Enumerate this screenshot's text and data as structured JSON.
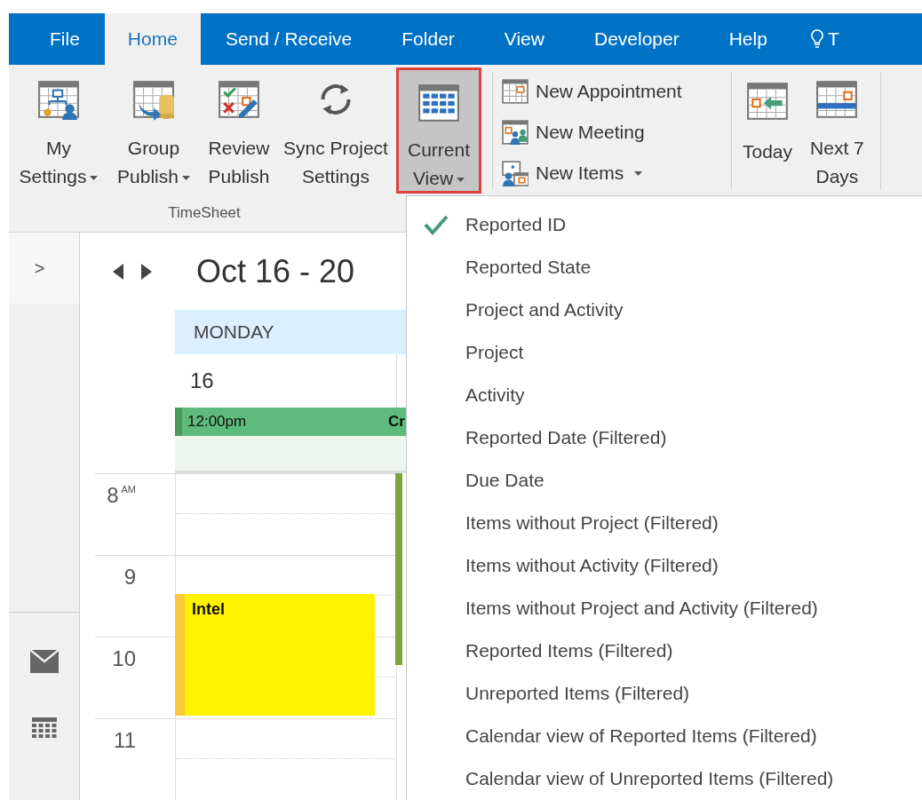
{
  "tabs": [
    {
      "label": "File",
      "selected": false
    },
    {
      "label": "Home",
      "selected": true
    },
    {
      "label": "Send / Receive",
      "selected": false
    },
    {
      "label": "Folder",
      "selected": false
    },
    {
      "label": "View",
      "selected": false
    },
    {
      "label": "Developer",
      "selected": false
    },
    {
      "label": "Help",
      "selected": false
    }
  ],
  "tell_me": {
    "text": "T"
  },
  "ribbon": {
    "timesheet": {
      "label": "TimeSheet",
      "buttons": [
        {
          "lines": [
            "My",
            "Settings"
          ],
          "kind": "org-chart",
          "dropdown": true
        },
        {
          "lines": [
            "Group",
            "Publish"
          ],
          "kind": "publish",
          "dropdown": true
        },
        {
          "lines": [
            "Review",
            "Publish"
          ],
          "kind": "review",
          "dropdown": false
        },
        {
          "lines": [
            "Sync Project",
            "Settings"
          ],
          "kind": "sync",
          "dropdown": false
        }
      ]
    },
    "current_view": {
      "lines": [
        "Current",
        "View"
      ],
      "dropdown": true,
      "pressed": true
    },
    "new_buttons": [
      {
        "label": "New Appointment",
        "kind": "appointment",
        "dropdown": false
      },
      {
        "label": "New Meeting",
        "kind": "meeting",
        "dropdown": false
      },
      {
        "label": "New Items",
        "kind": "items",
        "dropdown": true
      }
    ],
    "goto_buttons": [
      {
        "lines": [
          "Today"
        ],
        "kind": "today"
      },
      {
        "lines": [
          "Next 7",
          "Days"
        ],
        "kind": "week"
      }
    ]
  },
  "view_menu": [
    {
      "label": "Reported ID",
      "checked": true
    },
    {
      "label": "Reported State",
      "checked": false
    },
    {
      "label": "Project and Activity",
      "checked": false
    },
    {
      "label": "Project",
      "checked": false
    },
    {
      "label": "Activity",
      "checked": false
    },
    {
      "label": "Reported Date (Filtered)",
      "checked": false
    },
    {
      "label": "Due Date",
      "checked": false
    },
    {
      "label": "Items without Project (Filtered)",
      "checked": false
    },
    {
      "label": "Items without Activity (Filtered)",
      "checked": false
    },
    {
      "label": "Items without Project and Activity (Filtered)",
      "checked": false
    },
    {
      "label": "Reported Items (Filtered)",
      "checked": false
    },
    {
      "label": "Unreported Items (Filtered)",
      "checked": false
    },
    {
      "label": "Calendar view of Reported Items (Filtered)",
      "checked": false
    },
    {
      "label": "Calendar view of Unreported Items (Filtered)",
      "checked": false
    }
  ],
  "calendar": {
    "expand": ">",
    "range": "Oct 16 - 20",
    "day": "MONDAY",
    "date": "16",
    "all_day_event": {
      "time": "12:00pm",
      "title": "Cr"
    },
    "hours": [
      {
        "hour": "8",
        "suffix": "AM"
      },
      {
        "hour": "9"
      },
      {
        "hour": "10"
      },
      {
        "hour": "11"
      }
    ],
    "appointments": [
      {
        "title": "Intel",
        "color": "#fff200"
      }
    ]
  }
}
